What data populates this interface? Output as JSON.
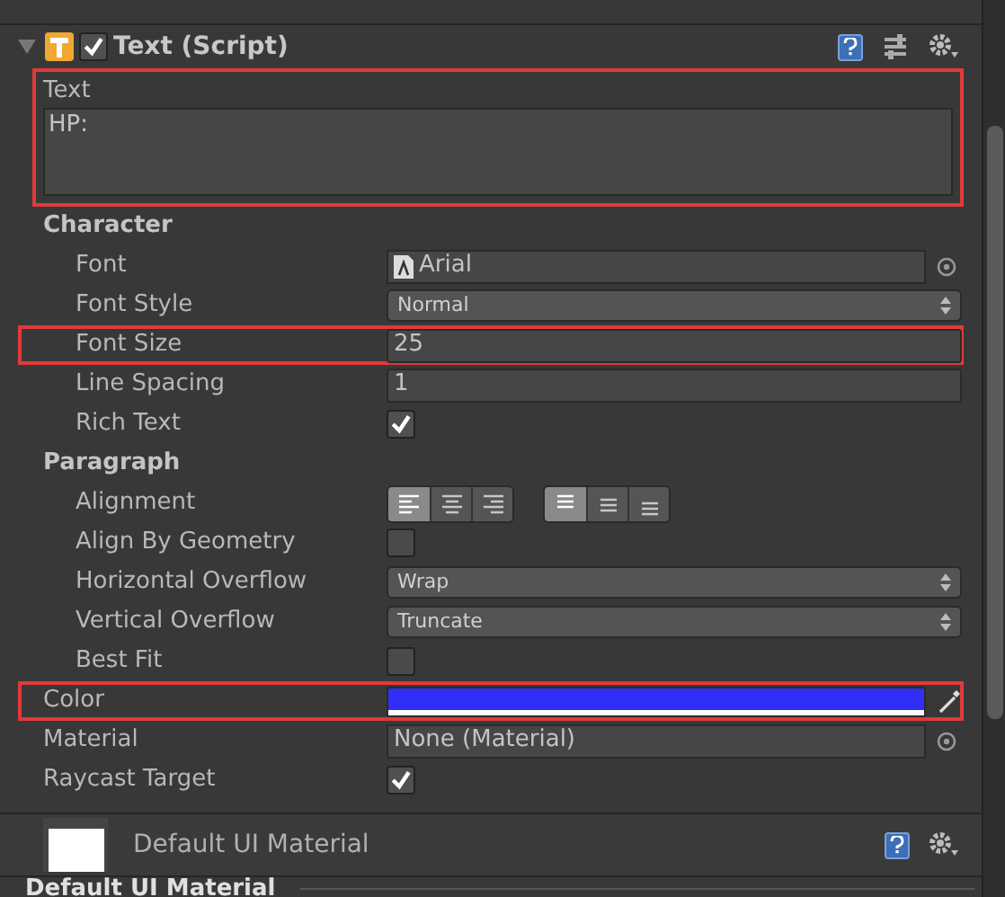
{
  "component": {
    "title": "Text (Script)",
    "enabled": true,
    "expanded": true
  },
  "text_property": {
    "label": "Text",
    "value": "HP:",
    "highlighted": true
  },
  "sections": [
    {
      "title": "Character",
      "rows": [
        {
          "kind": "font_object",
          "label": "Font",
          "value": "Arial",
          "highlighted": false
        },
        {
          "kind": "dropdown",
          "label": "Font Style",
          "value": "Normal",
          "highlighted": false
        },
        {
          "kind": "field",
          "label": "Font Size",
          "value": "25",
          "highlighted": true
        },
        {
          "kind": "field",
          "label": "Line Spacing",
          "value": "1",
          "highlighted": false
        },
        {
          "kind": "checkbox",
          "label": "Rich Text",
          "checked": true,
          "highlighted": false
        }
      ]
    },
    {
      "title": "Paragraph",
      "rows": [
        {
          "kind": "alignment",
          "label": "Alignment",
          "horizontal": [
            {
              "selected": true
            },
            {
              "selected": false
            },
            {
              "selected": false
            }
          ],
          "vertical": [
            {
              "selected": true
            },
            {
              "selected": false
            },
            {
              "selected": false
            }
          ],
          "highlighted": false
        },
        {
          "kind": "checkbox",
          "label": "Align By Geometry",
          "checked": false,
          "highlighted": false
        },
        {
          "kind": "dropdown",
          "label": "Horizontal Overflow",
          "value": "Wrap",
          "highlighted": false
        },
        {
          "kind": "dropdown",
          "label": "Vertical Overflow",
          "value": "Truncate",
          "highlighted": false
        },
        {
          "kind": "checkbox",
          "label": "Best Fit",
          "checked": false,
          "highlighted": false
        }
      ]
    }
  ],
  "rows": [
    {
      "kind": "color",
      "label": "Color",
      "color": "#2f2ff5",
      "highlighted": true
    },
    {
      "kind": "object",
      "label": "Material",
      "value": "None (Material)",
      "highlighted": false
    },
    {
      "kind": "checkbox",
      "label": "Raycast Target",
      "checked": true,
      "highlighted": false
    }
  ],
  "material": {
    "name": "Default UI Material"
  },
  "footer": {
    "label": "Default UI Material"
  }
}
